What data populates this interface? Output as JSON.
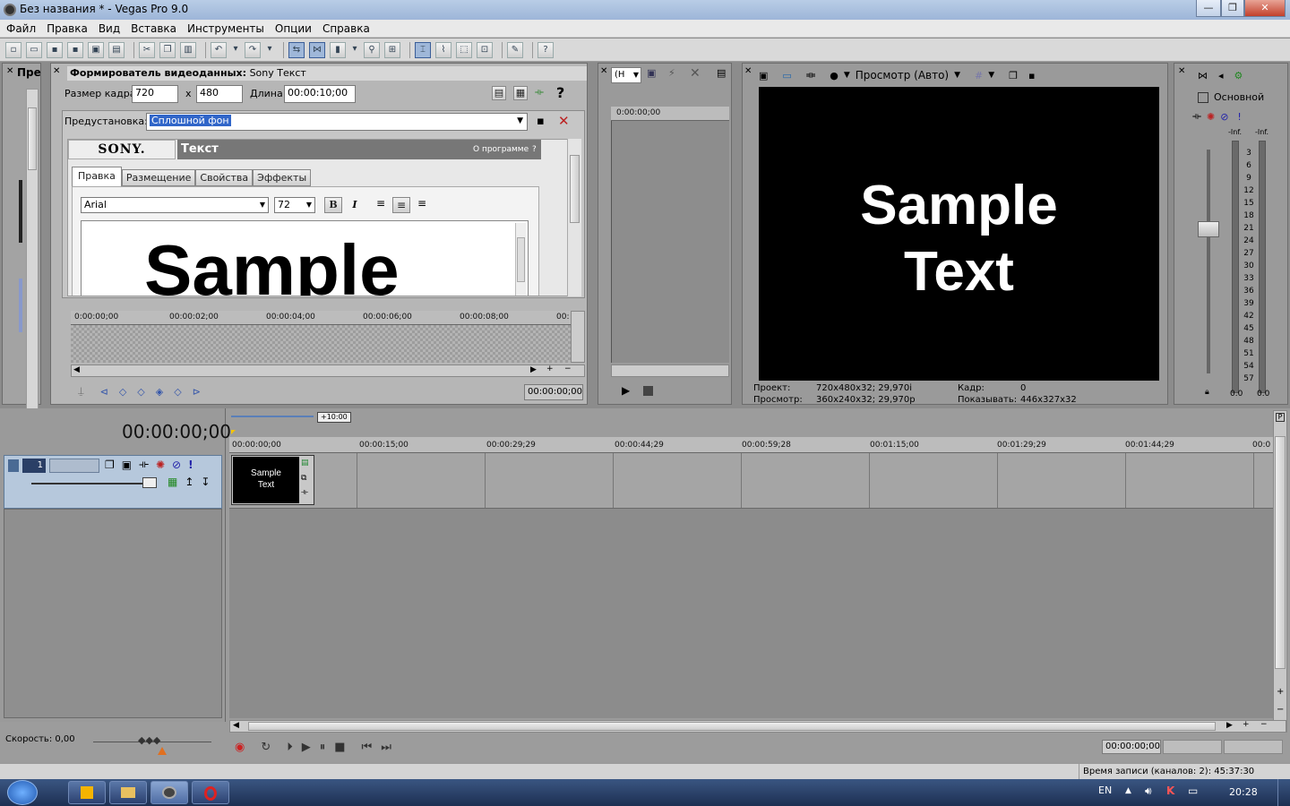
{
  "window": {
    "title": "Без названия * - Vegas Pro 9.0",
    "controls": [
      "—",
      "❐",
      "✕"
    ]
  },
  "menu": [
    "Файл",
    "Правка",
    "Вид",
    "Вставка",
    "Инструменты",
    "Опции",
    "Справка"
  ],
  "explorer_panel": {
    "tab": "Пре"
  },
  "generator": {
    "header_label": "Формирователь видеоданных:",
    "header_name": "Sony Текст",
    "frame_size_label": "Размер кадра:",
    "width": "720",
    "x_label": "x",
    "height": "480",
    "length_label": "Длина:",
    "length": "00:00:10;00",
    "preset_label": "Предустановка:",
    "preset_value": "Сплошной фон",
    "sony_logo": "SONY.",
    "plugin_title": "Текст",
    "about_link": "О программе",
    "about_q": "?",
    "tabs": [
      "Правка",
      "Размещение",
      "Свойства",
      "Эффекты"
    ],
    "font_name": "Arial",
    "font_size": "72",
    "bold": "B",
    "italic": "I",
    "edit_text": "Sample",
    "ruler_ticks": [
      "0:00:00;00",
      "00:00:02;00",
      "00:00:04;00",
      "00:00:06;00",
      "00:00:08;00",
      "00:"
    ],
    "time": "00:00:00;00"
  },
  "trimmer": {
    "combo": "(Н",
    "time": "0:00:00;00"
  },
  "preview": {
    "mode": "Просмотр (Авто)",
    "line1": "Sample",
    "line2": "Text",
    "project_label": "Проект:",
    "project_value": "720x480x32; 29,970i",
    "preview_label": "Просмотр:",
    "preview_value": "360x240x32; 29,970p",
    "frame_label": "Кадр:",
    "frame_value": "0",
    "display_label": "Показывать:",
    "display_value": "446x327x32"
  },
  "master": {
    "title": "Основной",
    "inf_left": "-Inf.",
    "inf_right": "-Inf.",
    "scale": [
      "3",
      "6",
      "9",
      "12",
      "15",
      "18",
      "21",
      "24",
      "27",
      "30",
      "33",
      "36",
      "39",
      "42",
      "45",
      "48",
      "51",
      "54",
      "57"
    ],
    "value_left": "0.0",
    "value_right": "0.0"
  },
  "timeline": {
    "current_time": "00:00:00;00",
    "region_label": "+10:00",
    "ruler_ticks": [
      "00:00:00;00",
      "00:00:15;00",
      "00:00:29;29",
      "00:00:44;29",
      "00:00:59;28",
      "00:01:15;00",
      "00:01:29;29",
      "00:01:44;29",
      "00:0"
    ],
    "track_number": "1",
    "event_line1": "Sample",
    "event_line2": "Text",
    "speed_label": "Скорость: 0,00",
    "transport_time": "00:00:00;00"
  },
  "status": {
    "record_time": "Время записи (каналов: 2): 45:37:30"
  },
  "taskbar": {
    "language": "EN",
    "clock": "20:28"
  }
}
